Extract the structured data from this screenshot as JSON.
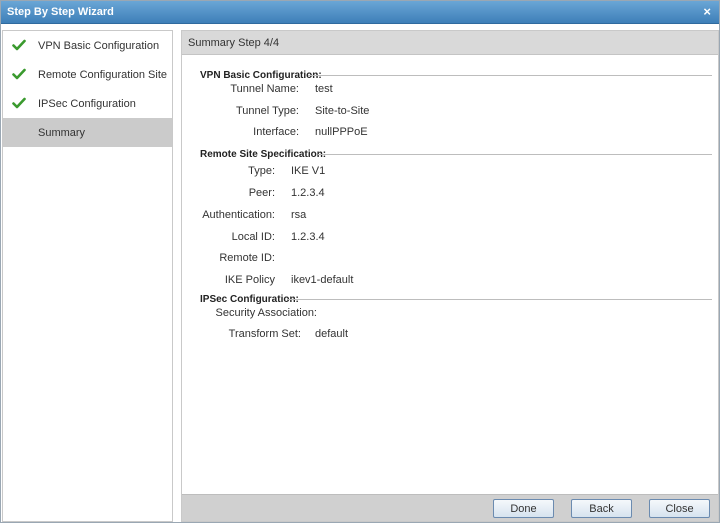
{
  "window": {
    "title": "Step By Step Wizard",
    "close_glyph": "×"
  },
  "steps": [
    {
      "label": "VPN Basic Configuration",
      "done": true
    },
    {
      "label": "Remote Configuration Site",
      "done": true
    },
    {
      "label": "IPSec Configuration",
      "done": true
    },
    {
      "label": "Summary",
      "done": false,
      "active": true
    }
  ],
  "header": {
    "title": "Summary  Step 4/4"
  },
  "sections": {
    "vpn_basic": {
      "title": "VPN Basic Configuration:",
      "fields": [
        {
          "label": "Tunnel Name:",
          "value": "test"
        },
        {
          "label": "Tunnel Type:",
          "value": "Site-to-Site"
        },
        {
          "label": "Interface:",
          "value": "nullPPPoE"
        }
      ]
    },
    "remote_site": {
      "title": "Remote Site Specification:",
      "fields": [
        {
          "label": "Type:",
          "value": "IKE V1"
        },
        {
          "label": "Peer:",
          "value": "1.2.3.4"
        },
        {
          "label": "Authentication:",
          "value": "rsa"
        },
        {
          "label": "Local ID:",
          "value": "1.2.3.4"
        },
        {
          "label": "Remote ID:",
          "value": ""
        },
        {
          "label": "IKE Policy",
          "value": "ikev1-default"
        }
      ]
    },
    "ipsec": {
      "title": "IPSec Configuration:",
      "fields": [
        {
          "label": "Security Association:",
          "value": ""
        },
        {
          "label": "Transform Set:",
          "value": "default"
        }
      ]
    }
  },
  "buttons": {
    "done": "Done",
    "back": "Back",
    "close": "Close"
  },
  "colors": {
    "titlebar": "#4a8bc4",
    "check": "#3a9a2e",
    "active_step": "#cbcbcb"
  }
}
